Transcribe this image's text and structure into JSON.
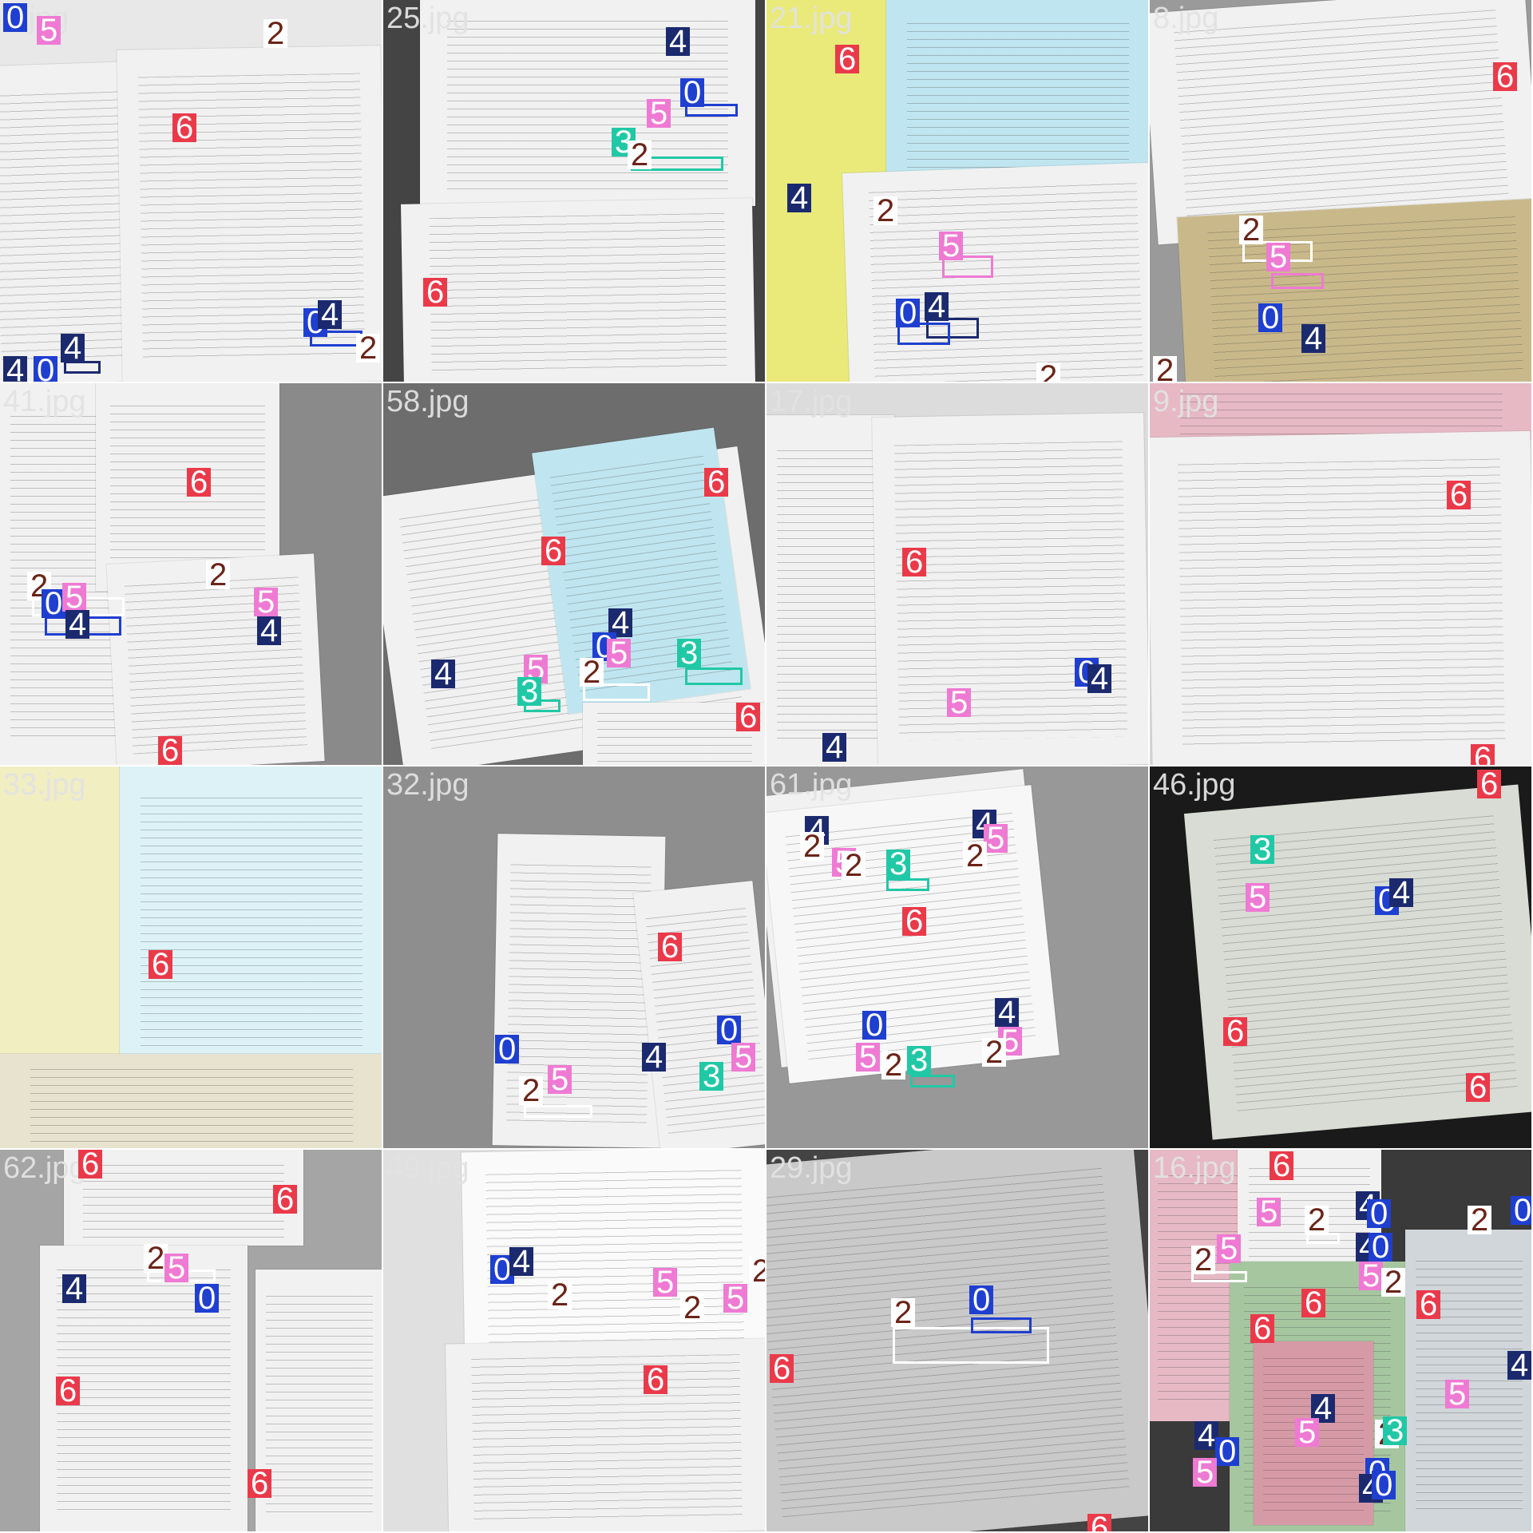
{
  "tiles": [
    {
      "name": "5.jpg",
      "labels": [
        "0",
        "5",
        "2",
        "6",
        "0",
        "4",
        "2",
        "4",
        "0",
        "4"
      ]
    },
    {
      "name": "25.jpg",
      "labels": [
        "4",
        "0",
        "5",
        "3",
        "2",
        "6"
      ]
    },
    {
      "name": "21.jpg",
      "labels": [
        "6",
        "4",
        "2",
        "5",
        "0",
        "4",
        "2"
      ]
    },
    {
      "name": "8.jpg",
      "labels": [
        "6",
        "2",
        "5",
        "0",
        "4",
        "2"
      ]
    },
    {
      "name": "41.jpg",
      "labels": [
        "6",
        "2",
        "2",
        "0",
        "5",
        "4",
        "5",
        "4",
        "6"
      ]
    },
    {
      "name": "58.jpg",
      "labels": [
        "6",
        "6",
        "4",
        "0",
        "5",
        "3",
        "4",
        "5",
        "3",
        "2",
        "6"
      ]
    },
    {
      "name": "17.jpg",
      "labels": [
        "6",
        "0",
        "4",
        "5",
        "4"
      ]
    },
    {
      "name": "9.jpg",
      "labels": [
        "6",
        "6"
      ]
    },
    {
      "name": "33.jpg",
      "labels": [
        "6"
      ]
    },
    {
      "name": "32.jpg",
      "labels": [
        "6",
        "0",
        "4",
        "0",
        "2",
        "5",
        "5",
        "3"
      ]
    },
    {
      "name": "61.jpg",
      "labels": [
        "4",
        "2",
        "5",
        "2",
        "3",
        "4",
        "5",
        "2",
        "6",
        "4",
        "0",
        "5",
        "2",
        "3",
        "5",
        "2"
      ]
    },
    {
      "name": "46.jpg",
      "labels": [
        "6",
        "3",
        "5",
        "0",
        "4",
        "6",
        "6"
      ]
    },
    {
      "name": "62.jpg",
      "labels": [
        "6",
        "6",
        "2",
        "5",
        "4",
        "0",
        "6",
        "6"
      ]
    },
    {
      "name": "49.jpg",
      "labels": [
        "0",
        "4",
        "2",
        "5",
        "2",
        "5",
        "2",
        "6"
      ]
    },
    {
      "name": "29.jpg",
      "labels": [
        "0",
        "2",
        "6",
        "6"
      ]
    },
    {
      "name": "16.jpg",
      "labels": [
        "6",
        "5",
        "2",
        "4",
        "0",
        "2",
        "0",
        "4",
        "0",
        "2",
        "5",
        "5",
        "6",
        "2",
        "6",
        "6",
        "4",
        "5",
        "4",
        "0",
        "2",
        "5",
        "3",
        "5",
        "0",
        "4",
        "0",
        "4"
      ]
    }
  ]
}
